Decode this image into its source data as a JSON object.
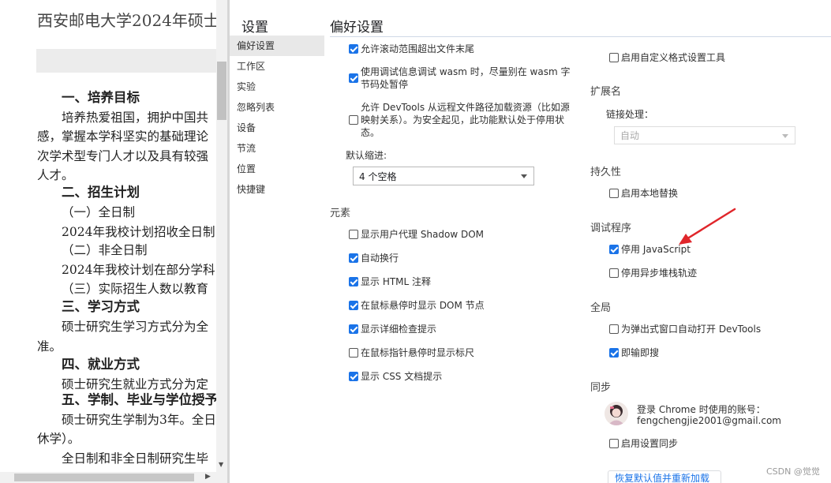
{
  "document": {
    "title": "西安邮电大学2024年硕士",
    "lines": [
      {
        "text": "一、培养目标",
        "heading": true
      },
      {
        "text": "培养热爱祖国，拥护中国共",
        "heading": false
      },
      {
        "text": "感，掌握本学科坚实的基础理论",
        "heading": false
      },
      {
        "text": "次学术型专门人才以及具有较强",
        "heading": false
      },
      {
        "text": "人才。",
        "heading": false
      },
      {
        "text": "二、招生计划",
        "heading": true
      },
      {
        "text": "（一）全日制",
        "heading": false
      },
      {
        "text": "2024年我校计划招收全日制",
        "heading": false
      },
      {
        "text": "（二）非全日制",
        "heading": false
      },
      {
        "text": "2024年我校计划在部分学科",
        "heading": false
      },
      {
        "text": "（三）实际招生人数以教育",
        "heading": false
      },
      {
        "text": "三、学习方式",
        "heading": true
      },
      {
        "text": "硕士研究生学习方式分为全",
        "heading": false
      },
      {
        "text": "准。",
        "heading": false
      },
      {
        "text": "四、就业方式",
        "heading": true
      },
      {
        "text": "硕士研究生就业方式分为定",
        "heading": false
      },
      {
        "text": "五、学制、毕业与学位授予",
        "heading": true
      },
      {
        "text": "硕士研究生学制为3年。全日",
        "heading": false
      },
      {
        "text": "休学）。",
        "heading": false
      },
      {
        "text": "全日制和非全日制研究生毕",
        "heading": false
      }
    ]
  },
  "settings": {
    "sidebar_title": "设置",
    "nav": [
      {
        "label": "偏好设置",
        "active": true
      },
      {
        "label": "工作区",
        "active": false
      },
      {
        "label": "实验",
        "active": false
      },
      {
        "label": "忽略列表",
        "active": false
      },
      {
        "label": "设备",
        "active": false
      },
      {
        "label": "节流",
        "active": false
      },
      {
        "label": "位置",
        "active": false
      },
      {
        "label": "快捷键",
        "active": false
      }
    ],
    "main_title": "偏好设置",
    "col1": {
      "top_checks": [
        {
          "label": "允许滚动范围超出文件末尾",
          "checked": true
        },
        {
          "label": "使用调试信息调试 wasm 时，尽量别在 wasm 字节码处暂停",
          "checked": true
        },
        {
          "label": "允许 DevTools 从远程文件路径加载资源（比如源映射关系）。为安全起见，此功能默认处于停用状态。",
          "checked": false
        }
      ],
      "indent_label": "默认缩进:",
      "indent_value": "4 个空格",
      "elements_header": "元素",
      "elements_checks": [
        {
          "label": "显示用户代理 Shadow DOM",
          "checked": false
        },
        {
          "label": "自动换行",
          "checked": true
        },
        {
          "label": "显示 HTML 注释",
          "checked": true
        },
        {
          "label": "在鼠标悬停时显示 DOM 节点",
          "checked": true
        },
        {
          "label": "显示详细检查提示",
          "checked": true
        },
        {
          "label": "在鼠标指针悬停时显示标尺",
          "checked": false
        },
        {
          "label": "显示 CSS 文档提示",
          "checked": true
        }
      ]
    },
    "col2": {
      "custom_formatters": {
        "label": "启用自定义格式设置工具",
        "checked": false
      },
      "extensions_header": "扩展名",
      "link_handling_label": "链接处理：",
      "link_handling_value": "自动",
      "persistence_header": "持久性",
      "local_overrides": {
        "label": "启用本地替换",
        "checked": false
      },
      "debugger_header": "调试程序",
      "disable_js": {
        "label": "停用 JavaScript",
        "checked": true
      },
      "disable_async": {
        "label": "停用异步堆栈轨迹",
        "checked": false
      },
      "global_header": "全局",
      "auto_open_devtools": {
        "label": "为弹出式窗口自动打开 DevTools",
        "checked": false
      },
      "search_as_type": {
        "label": "即输即搜",
        "checked": true
      },
      "sync_header": "同步",
      "account_line1": "登录 Chrome 时使用的账号：",
      "account_email": "fengchengjie2001@gmail.com",
      "settings_sync": {
        "label": "启用设置同步",
        "checked": false
      },
      "restore_button": "恢复默认值并重新加载"
    },
    "annotation_color": "#e0262b",
    "accent_color": "#1a73e8"
  },
  "watermark": "CSDN @觉觉"
}
